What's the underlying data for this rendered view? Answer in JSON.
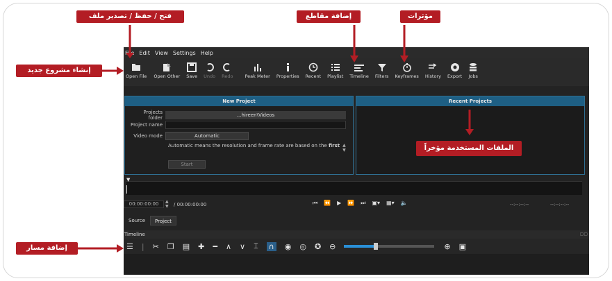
{
  "menu": [
    "File",
    "Edit",
    "View",
    "Settings",
    "Help"
  ],
  "toolbar": [
    {
      "label": "Open File",
      "icon": "folder-icon",
      "enabled": true
    },
    {
      "label": "Open Other",
      "icon": "open-other-icon",
      "enabled": true
    },
    {
      "label": "Save",
      "icon": "save-icon",
      "enabled": true
    },
    {
      "label": "Undo",
      "icon": "undo-icon",
      "enabled": false
    },
    {
      "label": "Redo",
      "icon": "redo-icon",
      "enabled": false
    },
    {
      "label": "Peak Meter",
      "icon": "peak-meter-icon",
      "enabled": true
    },
    {
      "label": "Properties",
      "icon": "info-icon",
      "enabled": true
    },
    {
      "label": "Recent",
      "icon": "clock-icon",
      "enabled": true
    },
    {
      "label": "Playlist",
      "icon": "list-icon",
      "enabled": true
    },
    {
      "label": "Timeline",
      "icon": "timeline-icon",
      "enabled": true
    },
    {
      "label": "Filters",
      "icon": "filter-icon",
      "enabled": true
    },
    {
      "label": "Keyframes",
      "icon": "stopwatch-icon",
      "enabled": true
    },
    {
      "label": "History",
      "icon": "history-icon",
      "enabled": true
    },
    {
      "label": "Export",
      "icon": "export-icon",
      "enabled": true
    },
    {
      "label": "Jobs",
      "icon": "jobs-icon",
      "enabled": true
    }
  ],
  "new_project": {
    "title": "New Project",
    "folder_label": "Projects folder",
    "folder_value": "...hireen\\Videos",
    "name_label": "Project name",
    "name_value": "",
    "mode_label": "Video mode",
    "mode_value": "Automatic",
    "help_text": "Automatic means the resolution and frame rate are based on the",
    "help_bold": "first",
    "start_label": "Start"
  },
  "recent_projects": {
    "title": "Recent Projects"
  },
  "player": {
    "timecode": "00:00:00:00",
    "duration": "/ 00:00:00:00",
    "in_point": "--:--:--:--",
    "out_point": "--:--:--:--"
  },
  "tabs": [
    "Source",
    "Project"
  ],
  "timeline": {
    "label": "Timeline"
  },
  "callouts": {
    "file": "فتح / حفظ / تصدير ملف",
    "playlist": "إضافة مقاطع",
    "filters": "مؤثرات",
    "new_project": "إنشاء مشروع جديد",
    "recent": "الملفات المستخدمة مؤخراً",
    "track": "إضافة مسار"
  },
  "colors": {
    "callout": "#b31d24",
    "panel_header": "#1e5f84",
    "accent": "#2a8fd6"
  }
}
